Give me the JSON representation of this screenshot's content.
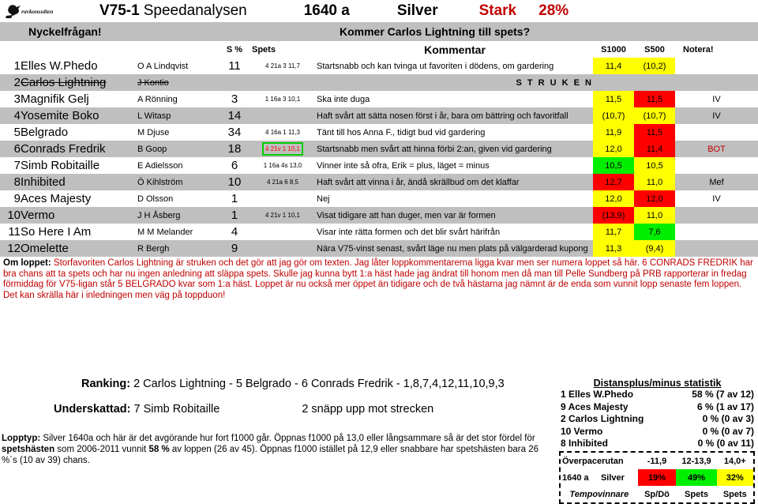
{
  "header": {
    "race": "V75-1",
    "analysis": "Speedanalysen",
    "distance": "1640 a",
    "grade": "Silver",
    "strength": "Stark",
    "pct": "28%",
    "logo_text": "ravkonsulten"
  },
  "keybar": {
    "label": "Nyckelfrågan!",
    "question": "Kommer Carlos Lightning till spets?"
  },
  "columns": {
    "spct": "S %",
    "spets": "Spets",
    "kommentar": "Kommentar",
    "s1000": "S1000",
    "s500": "S500",
    "notera": "Notera!"
  },
  "rows": [
    {
      "no": "1",
      "horse": "Elles W.Phedo",
      "driver": "O A Lindqvist",
      "spct": "11",
      "spets": "4 21a 3 11,7",
      "komm": "Startsnabb och kan  tvinga ut favoriten i dödens, om gardering",
      "s1000": "11,4",
      "s500": "(10,2)",
      "notera": "",
      "s1000_hl": "yellow",
      "s500_hl": "yellow",
      "notera_color": "black",
      "shade": false,
      "struck": false
    },
    {
      "no": "2",
      "horse": "Carlos Lightning",
      "driver": "J Kontio",
      "spct": "",
      "spets": "",
      "komm": "S T R U K E N",
      "s1000": "",
      "s500": "",
      "notera": "",
      "s1000_hl": "none",
      "s500_hl": "none",
      "notera_color": "black",
      "shade": true,
      "struck": true
    },
    {
      "no": "3",
      "horse": "Magnifik Gelj",
      "driver": "A Rönning",
      "spct": "3",
      "spets": "1 16a 3 10,1",
      "komm": "Ska inte duga",
      "s1000": "11,5",
      "s500": "11,5",
      "notera": "IV",
      "s1000_hl": "yellow",
      "s500_hl": "red",
      "notera_color": "black",
      "shade": false,
      "struck": false
    },
    {
      "no": "4",
      "horse": "Yosemite Boko",
      "driver": "L Witasp",
      "spct": "14",
      "spets": "",
      "komm": "Haft svårt att sätta nosen först i år, bara om bättring och favoritfall",
      "s1000": "(10,7)",
      "s500": "(10,7)",
      "notera": "IV",
      "s1000_hl": "yellow",
      "s500_hl": "yellow",
      "notera_color": "black",
      "shade": true,
      "struck": false
    },
    {
      "no": "5",
      "horse": "Belgrado",
      "driver": "M Djuse",
      "spct": "34",
      "spets": "4 16a 1 11,3",
      "komm": "Tänt till hos Anna F., tidigt bud vid gardering",
      "s1000": "11,9",
      "s500": "11,5",
      "notera": "",
      "s1000_hl": "yellow",
      "s500_hl": "red",
      "notera_color": "black",
      "shade": false,
      "struck": false
    },
    {
      "no": "6",
      "horse": "Conrads Fredrik",
      "driver": "B Goop",
      "spct": "18",
      "spets": "4 21v 1 10,1",
      "komm": "Startsnabb men svårt att hinna förbi 2:an, given vid gardering",
      "s1000": "12,0",
      "s500": "11,4",
      "notera": "BOT",
      "s1000_hl": "yellow",
      "s500_hl": "red",
      "notera_color": "red",
      "shade": true,
      "struck": false,
      "spets_box": true
    },
    {
      "no": "7",
      "horse": "Simb Robitaille",
      "driver": "E Adielsson",
      "spct": "6",
      "spets": "1 16a 4s 13,0",
      "komm": "Vinner inte så ofra, Erik = plus, läget = minus",
      "s1000": "10,5",
      "s500": "10,5",
      "notera": "",
      "s1000_hl": "green",
      "s500_hl": "yellow",
      "notera_color": "black",
      "shade": false,
      "struck": false
    },
    {
      "no": "8",
      "horse": "Inhibited",
      "driver": "Ö Kihlström",
      "spct": "10",
      "spets": "4 21a 6  8,5",
      "komm": "Haft svårt att vinna i år, ändå skrällbud om det klaffar",
      "s1000": "12,7",
      "s500": "11,0",
      "notera": "Mef",
      "s1000_hl": "red",
      "s500_hl": "yellow",
      "notera_color": "black",
      "shade": true,
      "struck": false
    },
    {
      "no": "9",
      "horse": "Aces Majesty",
      "driver": "D Olsson",
      "spct": "1",
      "spets": "",
      "komm": "Nej",
      "s1000": "12,0",
      "s500": "12,0",
      "notera": "IV",
      "s1000_hl": "yellow",
      "s500_hl": "red",
      "notera_color": "black",
      "shade": false,
      "struck": false
    },
    {
      "no": "10",
      "horse": "Vermo",
      "driver": "J H Åsberg",
      "spct": "1",
      "spets": "4 21v 1 10,1",
      "komm": "Visat tidigare att han duger, men var är formen",
      "s1000": "(13,9)",
      "s500": "11,0",
      "notera": "",
      "s1000_hl": "red",
      "s500_hl": "yellow",
      "notera_color": "black",
      "shade": true,
      "struck": false
    },
    {
      "no": "11",
      "horse": "So  Here I Am",
      "driver": "M M Melander",
      "spct": "4",
      "spets": "",
      "komm": "Visar inte rätta formen och det blir svårt härifrån",
      "s1000": "11,7",
      "s500": "7,6",
      "notera": "",
      "s1000_hl": "yellow",
      "s500_hl": "green",
      "notera_color": "black",
      "shade": false,
      "struck": false
    },
    {
      "no": "12",
      "horse": "Omelette",
      "driver": "R Bergh",
      "spct": "9",
      "spets": "",
      "komm": "Nära V75-vinst senast, svårt läge nu men plats på välgarderad kupong",
      "s1000": "11,3",
      "s500": "(9,4)",
      "notera": "",
      "s1000_hl": "yellow",
      "s500_hl": "yellow",
      "notera_color": "black",
      "shade": true,
      "struck": false
    }
  ],
  "om_loppet": {
    "label": "Om loppet:",
    "text": "Storfavoriten Carlos Lightning är struken och det gör att jag gör om texten. Jag låter loppkommentarerna ligga kvar men ser numera loppet så här. 6 CONRADS FREDRIK har bra chans att ta spets och har nu ingen anledning att släppa spets. Skulle jag kunna bytt 1:a häst hade jag ändrat till honom men då man till Pelle Sundberg på PRB rapporterar in fredag förmiddag för V75-ligan står 5 BELGRADO kvar som 1:a häst. Loppet är nu också mer öppet än tidigare och de två hästarna jag nämnt är de enda som vunnit lopp senaste fem loppen. Det kan skrälla här i inledningen men väg på toppduon!"
  },
  "ranking": {
    "label": "Ranking",
    "value": "2 Carlos Lightning - 5 Belgrado - 6 Conrads Fredrik - 1,8,7,4,12,11,10,9,3",
    "under_label": "Underskattad:",
    "under_value": "7 Simb Robitaille",
    "snapp": "2 snäpp upp mot strecken"
  },
  "stats": {
    "title": "Distansplus/minus statistik",
    "items": [
      {
        "name": "1 Elles W.Phedo",
        "value": "58 % (7 av 12)"
      },
      {
        "name": "9 Aces Majesty",
        "value": "6 % (1 av 17)"
      },
      {
        "name": "2 Carlos Lightning",
        "value": "0 % (0 av 3)"
      },
      {
        "name": "10 Vermo",
        "value": "0 % (0 av 7)"
      },
      {
        "name": "8 Inhibited",
        "value": "0 % (0 av 11)"
      }
    ]
  },
  "tempo": {
    "row1_label": "Överpacerutan",
    "c1": "-11,9",
    "c2": "12-13,9",
    "c3": "14,0+",
    "row2_label": "1640 a",
    "row2_label2": "Silver",
    "v1": "19%",
    "v2": "49%",
    "v3": "32%",
    "row3_label": "Tempovinnare",
    "t1": "Sp/Dö",
    "t2": "Spets",
    "t3": "Spets"
  },
  "lopptyp": {
    "label": "Lopptyp:",
    "part1": " Silver 1640a och här är det avgörande hur fort f1000 går. Öppnas f1000 på 13,0 eller långsammare så är det stor fördel för ",
    "bold1": "spetshästen",
    "part2": " som 2006-2011 vunnit ",
    "bold2": "58 %",
    "part3": " av loppen (26 av 45). Öppnas f1000 istället på 12,9 eller snabbare har spetshästen bara 26 %´s (10 av 39) chans."
  }
}
